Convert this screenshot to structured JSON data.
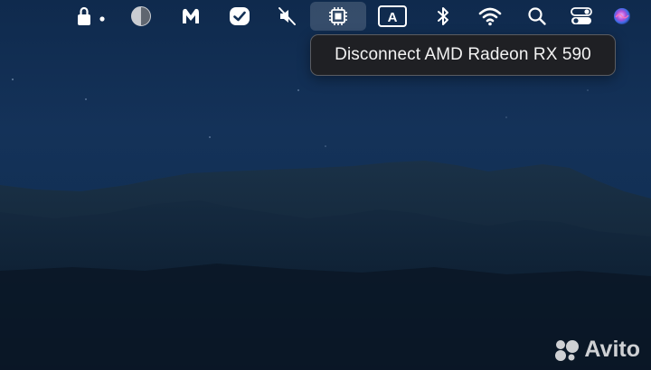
{
  "menubar": {
    "items": [
      {
        "name": "lock-status-icon"
      },
      {
        "name": "contrast-icon"
      },
      {
        "name": "malwarebytes-icon"
      },
      {
        "name": "check-shield-icon"
      },
      {
        "name": "mute-icon"
      },
      {
        "name": "gpu-chip-icon",
        "active": true
      },
      {
        "name": "input-source-icon",
        "letter": "A"
      },
      {
        "name": "bluetooth-icon"
      },
      {
        "name": "wifi-icon"
      },
      {
        "name": "search-icon"
      },
      {
        "name": "control-center-icon"
      },
      {
        "name": "siri-icon"
      }
    ]
  },
  "tooltip": {
    "text": "Disconnect AMD Radeon RX 590"
  },
  "watermark": {
    "text": "Avito"
  },
  "colors": {
    "sky_top": "#0f2a4d",
    "sky_mid": "#143259",
    "mountain": "#0b1c2e",
    "tooltip_bg": "#1f2024",
    "tooltip_border": "#5a5c61",
    "icon": "#ffffff"
  }
}
